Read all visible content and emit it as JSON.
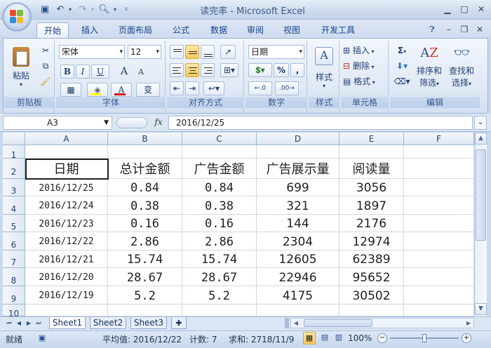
{
  "window": {
    "title": "读完率 - Microsoft Excel"
  },
  "ribbon": {
    "tabs": [
      "开始",
      "插入",
      "页面布局",
      "公式",
      "数据",
      "审阅",
      "视图",
      "开发工具"
    ],
    "active_tab": "开始",
    "clipboard": {
      "paste": "粘贴",
      "label": "剪贴板"
    },
    "font": {
      "family": "宋体",
      "size": "12",
      "label": "字体",
      "bold": "B",
      "italic": "I",
      "underline": "U",
      "grow": "A",
      "shrink": "A",
      "wen": "变"
    },
    "alignment": {
      "label": "对齐方式"
    },
    "number": {
      "format": "日期",
      "percent": "%",
      "comma": ",",
      "label": "数字"
    },
    "styles": {
      "label": "样式"
    },
    "cells": {
      "insert": "插入",
      "delete": "删除",
      "format": "格式",
      "label": "单元格"
    },
    "editing": {
      "sigma": "Σ",
      "sort": "排序和",
      "sort2": "筛选",
      "find": "查找和",
      "find2": "选择",
      "label": "编辑"
    }
  },
  "formula_bar": {
    "name_box": "A3",
    "fx": "fx",
    "formula": "2016/12/25"
  },
  "grid": {
    "columns": [
      "A",
      "B",
      "C",
      "D",
      "E",
      "F"
    ],
    "rows": [
      "1",
      "2",
      "3",
      "4",
      "5",
      "6",
      "7",
      "8",
      "9",
      "10"
    ],
    "headers": [
      "日期",
      "总计金额",
      "广告金额",
      "广告展示量",
      "阅读量"
    ],
    "data": [
      [
        "2016/12/25",
        "0.84",
        "0.84",
        "699",
        "3056"
      ],
      [
        "2016/12/24",
        "0.38",
        "0.38",
        "321",
        "1897"
      ],
      [
        "2016/12/23",
        "0.16",
        "0.16",
        "144",
        "2176"
      ],
      [
        "2016/12/22",
        "2.86",
        "2.86",
        "2304",
        "12974"
      ],
      [
        "2016/12/21",
        "15.74",
        "15.74",
        "12605",
        "62389"
      ],
      [
        "2016/12/20",
        "28.67",
        "28.67",
        "22946",
        "95652"
      ],
      [
        "2016/12/19",
        "5.2",
        "5.2",
        "4175",
        "30502"
      ]
    ]
  },
  "sheets": [
    "Sheet1",
    "Sheet2",
    "Sheet3"
  ],
  "status": {
    "ready": "就绪",
    "average": "平均值: 2016/12/22",
    "count": "计数: 7",
    "sum": "求和: 2718/11/9",
    "zoom": "100%"
  }
}
